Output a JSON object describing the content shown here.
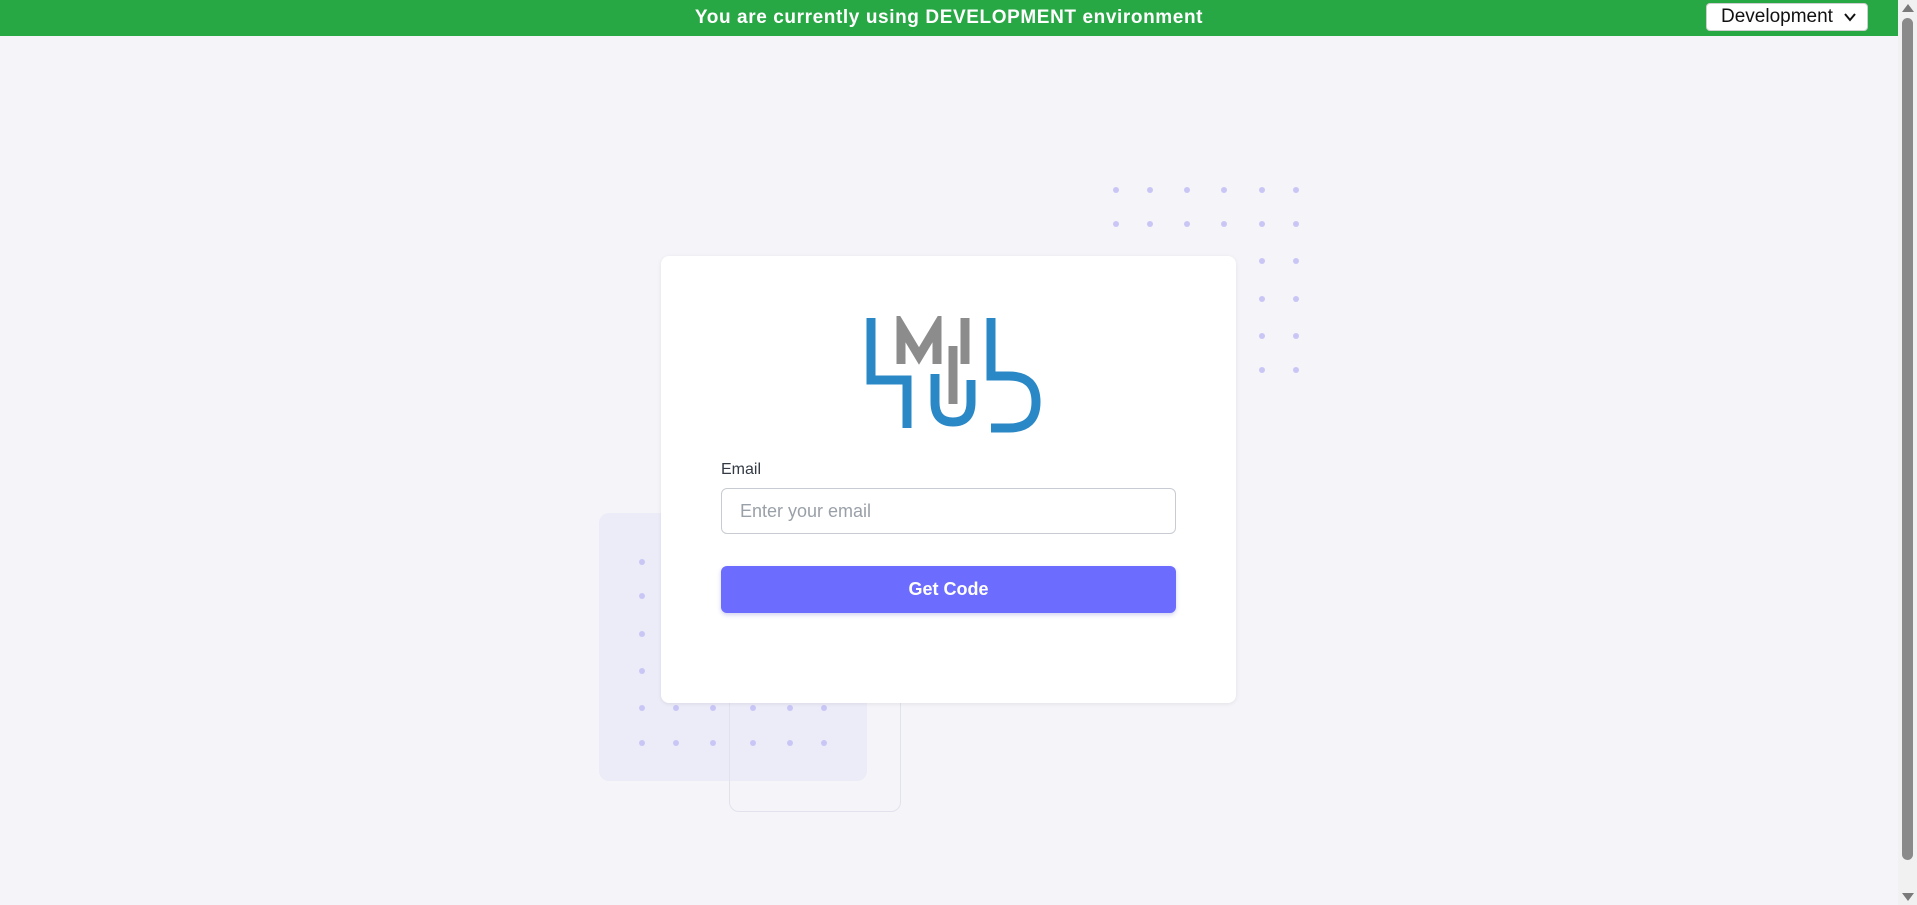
{
  "banner": {
    "message": "You are currently using DEVELOPMENT environment",
    "background_color": "#28a745",
    "environment_select": {
      "selected": "Development",
      "icon": "chevron-down-icon"
    }
  },
  "login": {
    "logo_icon": "lmi-hub-logo",
    "email_label": "Email",
    "email_value": "",
    "email_placeholder": "Enter your email",
    "submit_label": "Get Code",
    "accent_color": "#6c6cff"
  }
}
